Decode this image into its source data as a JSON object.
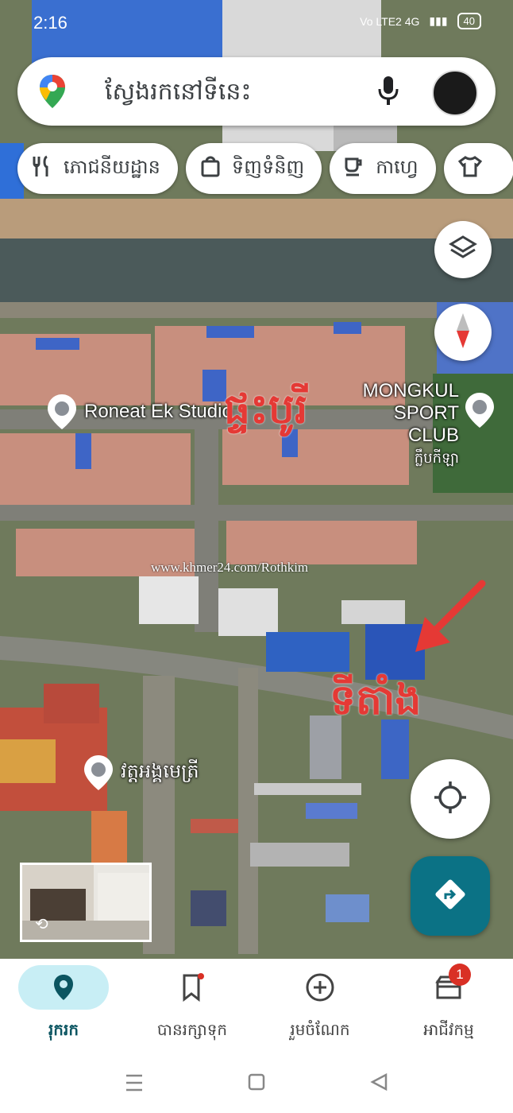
{
  "status_bar": {
    "time": "2:16",
    "network": "Vo LTE2 4G",
    "battery": "40"
  },
  "search": {
    "placeholder": "ស្វែងរកនៅទីនេះ"
  },
  "chips": [
    {
      "label": "ភោជនីយដ្ឋាន",
      "icon": "fork-knife-icon"
    },
    {
      "label": "ទិញទំនិញ",
      "icon": "shopping-bag-icon"
    },
    {
      "label": "កាហ្វេ",
      "icon": "coffee-icon"
    },
    {
      "label": "",
      "icon": "shirt-icon"
    }
  ],
  "map": {
    "pois": [
      {
        "name": "Roneat Ek Studio"
      },
      {
        "name": "MONGKUL SPORT CLUB",
        "subtitle": "ក្លឹបកីឡា"
      },
      {
        "name": "វត្តអង្គមេត្រី"
      }
    ],
    "overlay_text_top": "ផ្ទះបូរី",
    "overlay_text_location": "ទីតាំង",
    "watermark": "www.khmer24.com/Rothkim"
  },
  "bottom_nav": {
    "items": [
      {
        "label": "រុករក",
        "icon": "location-pin-icon",
        "active": true
      },
      {
        "label": "បានរក្សាទុក",
        "icon": "bookmark-icon",
        "badge_dot": true
      },
      {
        "label": "រួមចំណែក",
        "icon": "add-circle-icon"
      },
      {
        "label": "អាជីវកម្ម",
        "icon": "storefront-icon",
        "badge_count": "1"
      }
    ]
  },
  "colors": {
    "accent": "#0b7285",
    "active_pill": "#c8eef5",
    "badge": "#d93025",
    "annotation": "#e53935"
  }
}
